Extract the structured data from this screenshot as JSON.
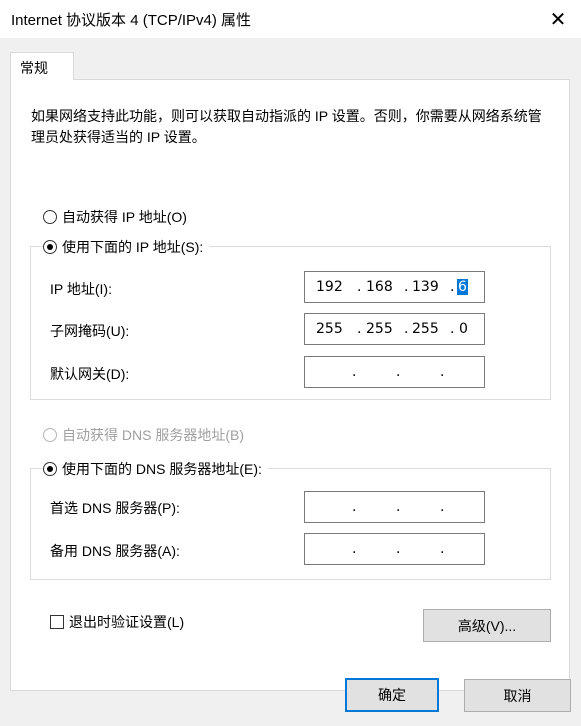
{
  "window": {
    "title": "Internet 协议版本 4 (TCP/IPv4) 属性",
    "close_glyph": "✕"
  },
  "tabs": [
    {
      "label": "常规",
      "selected": true
    }
  ],
  "description": "如果网络支持此功能，则可以获取自动指派的 IP 设置。否则，你需要从网络系统管理员处获得适当的 IP 设置。",
  "ip_section": {
    "auto_label": "自动获得 IP 地址(O)",
    "manual_label": "使用下面的 IP 地址(S):",
    "selected": "manual",
    "fields": {
      "ip_address": {
        "label": "IP 地址(I):",
        "octets": [
          "192",
          "168",
          "139",
          "6"
        ]
      },
      "subnet_mask": {
        "label": "子网掩码(U):",
        "octets": [
          "255",
          "255",
          "255",
          "0"
        ]
      },
      "gateway": {
        "label": "默认网关(D):",
        "octets": [
          "",
          "",
          "",
          ""
        ]
      }
    }
  },
  "dns_section": {
    "auto_label": "自动获得 DNS 服务器地址(B)",
    "auto_disabled": true,
    "manual_label": "使用下面的 DNS 服务器地址(E):",
    "selected": "manual",
    "fields": {
      "preferred": {
        "label": "首选 DNS 服务器(P):",
        "octets": [
          "",
          "",
          "",
          ""
        ]
      },
      "alternate": {
        "label": "备用 DNS 服务器(A):",
        "octets": [
          "",
          "",
          "",
          ""
        ]
      }
    }
  },
  "validate_on_exit": {
    "label": "退出时验证设置(L)",
    "checked": false
  },
  "buttons": {
    "advanced": "高级(V)...",
    "ok": "确定",
    "cancel": "取消"
  },
  "colors": {
    "accent": "#0078d7",
    "dialog_bg": "#f0f0f0",
    "disabled_text": "#a0a0a0"
  },
  "dot": "."
}
